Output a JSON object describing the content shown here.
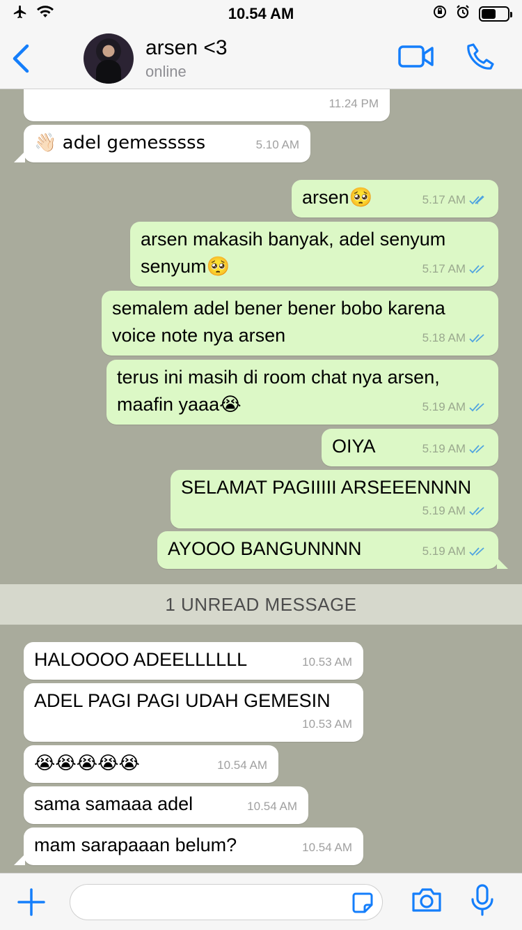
{
  "status_bar": {
    "time": "10.54 AM",
    "battery_level": 0.55
  },
  "header": {
    "contact_name": "arsen <3",
    "contact_status": "online"
  },
  "messages": [
    {
      "dir": "in",
      "text": "",
      "time": "11.24 PM"
    },
    {
      "dir": "in",
      "text": "👋🏻 adel gemesssss",
      "time": "5.10 AM"
    },
    {
      "dir": "out",
      "text": "arsen🥺",
      "time": "5.17 AM"
    },
    {
      "dir": "out",
      "text": "arsen makasih banyak, adel senyum senyum🥺",
      "time": "5.17 AM"
    },
    {
      "dir": "out",
      "text": "semalem adel bener bener bobo karena voice note nya arsen",
      "time": "5.18 AM"
    },
    {
      "dir": "out",
      "text": "terus ini masih di room chat nya arsen, maafin yaaa😭",
      "time": "5.19 AM"
    },
    {
      "dir": "out",
      "text": "OIYA",
      "time": "5.19 AM"
    },
    {
      "dir": "out",
      "text": "SELAMAT PAGIIIII ARSEEENNNN",
      "time": "5.19 AM"
    },
    {
      "dir": "out",
      "text": "AYOOO BANGUNNNN",
      "time": "5.19 AM"
    },
    {
      "dir": "in",
      "text": "HALOOOO ADEELLLLLL",
      "time": "10.53 AM"
    },
    {
      "dir": "in",
      "text": "ADEL PAGI PAGI UDAH GEMESIN",
      "time": "10.53 AM"
    },
    {
      "dir": "in",
      "text": "😭😭😭😭😭",
      "time": "10.54 AM"
    },
    {
      "dir": "in",
      "text": "sama samaaa adel",
      "time": "10.54 AM"
    },
    {
      "dir": "in",
      "text": "mam sarapaaan belum?",
      "time": "10.54 AM"
    }
  ],
  "unread_banner": "1 UNREAD MESSAGE",
  "input": {
    "value": "",
    "placeholder": ""
  },
  "colors": {
    "accent": "#147efb",
    "incoming_bubble": "#ffffff",
    "outgoing_bubble": "#dcf8c6",
    "read_check": "#4fa3e0",
    "chat_background": "#a9ab9c"
  }
}
